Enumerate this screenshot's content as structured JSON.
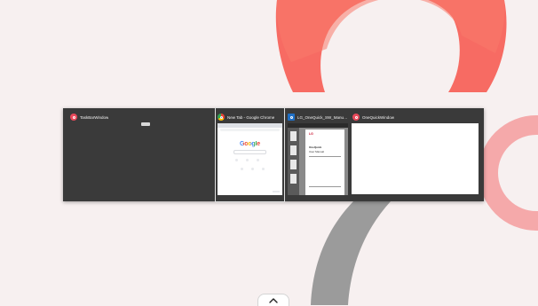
{
  "colors": {
    "desktop_background": "#f7f0f0",
    "switcher_background": "#3a3a3a",
    "accent_coral": "#f25f5c",
    "app_icon_red": "#e8495a"
  },
  "windows": [
    {
      "title": "TaskBarWindow",
      "icon": "onequick-app-icon",
      "selected": false
    },
    {
      "title": "New Tab - Google Chrome",
      "icon": "chrome-icon",
      "selected": true
    },
    {
      "title": "LG_OneQuick_SW_Manual_en...",
      "icon": "pdf-viewer-icon",
      "selected": false
    },
    {
      "title": "OneQuickWindow",
      "icon": "onequick-app-icon",
      "selected": false
    }
  ],
  "chrome_thumb": {
    "logo_text": "Google"
  },
  "pdf_thumb": {
    "logo": "LG",
    "heading": "OneQuick",
    "subtext": "User Manual"
  },
  "taskbar": {
    "expand_icon": "chevron-up-icon"
  }
}
